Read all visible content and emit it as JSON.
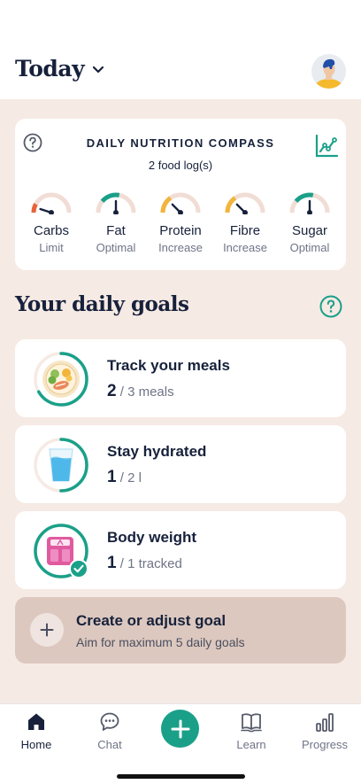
{
  "header": {
    "title": "Today"
  },
  "compass": {
    "title": "DAILY NUTRITION COMPASS",
    "subtitle": "2 food log(s)",
    "gauges": [
      {
        "name": "Carbs",
        "status": "Limit",
        "level": 0.1,
        "color": "#e8633a"
      },
      {
        "name": "Fat",
        "status": "Optimal",
        "level": 0.5,
        "color": "#1aa089"
      },
      {
        "name": "Protein",
        "status": "Increase",
        "level": 0.25,
        "color": "#f2b43a"
      },
      {
        "name": "Fibre",
        "status": "Increase",
        "level": 0.25,
        "color": "#f2b43a"
      },
      {
        "name": "Sugar",
        "status": "Optimal",
        "level": 0.5,
        "color": "#1aa089"
      }
    ]
  },
  "goals": {
    "title": "Your daily goals",
    "items": [
      {
        "title": "Track your meals",
        "current": "2",
        "target": "/ 3 meals",
        "fraction": 0.667
      },
      {
        "title": "Stay hydrated",
        "current": "1",
        "target": "/ 2 l",
        "fraction": 0.5
      },
      {
        "title": "Body weight",
        "current": "1",
        "target": "/ 1 tracked",
        "fraction": 1.0
      }
    ],
    "create": {
      "title": "Create or adjust goal",
      "subtitle": "Aim for maximum 5 daily goals"
    }
  },
  "nav": {
    "home": "Home",
    "chat": "Chat",
    "learn": "Learn",
    "progress": "Progress"
  },
  "colors": {
    "accent": "#1aa089",
    "background": "#f6eae4",
    "text": "#17213b"
  }
}
